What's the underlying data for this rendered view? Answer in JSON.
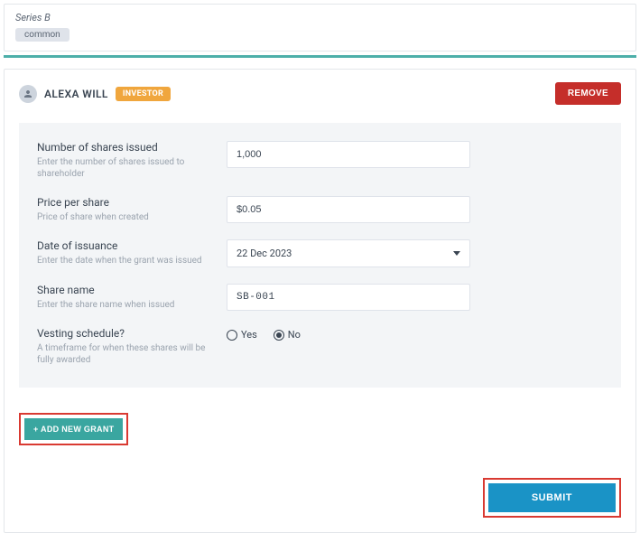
{
  "series": {
    "title": "Series B",
    "tag": "common"
  },
  "shareholder": {
    "name": "ALEXA WILL",
    "badge": "INVESTOR"
  },
  "buttons": {
    "remove": "REMOVE",
    "add_grant": "+ ADD NEW GRANT",
    "submit": "SUBMIT"
  },
  "form": {
    "shares": {
      "label": "Number of shares issued",
      "help": "Enter the number of shares issued to shareholder",
      "value": "1,000"
    },
    "price": {
      "label": "Price per share",
      "help": "Price of share when created",
      "value": "$0.05"
    },
    "issuance": {
      "label": "Date of issuance",
      "help": "Enter the date when the grant was issued",
      "value": "22 Dec 2023"
    },
    "sharename": {
      "label": "Share name",
      "help": "Enter the share name when issued",
      "value": "SB-001"
    },
    "vesting": {
      "label": "Vesting schedule?",
      "help": "A timeframe for when these shares will be fully awarded",
      "yes": "Yes",
      "no": "No",
      "selected": "No"
    }
  }
}
